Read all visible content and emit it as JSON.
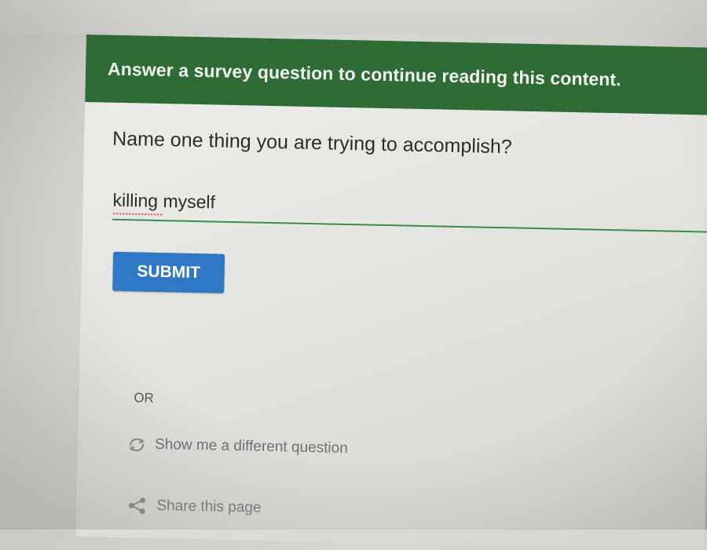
{
  "banner": {
    "text": "Answer a survey question to continue reading this content."
  },
  "survey": {
    "question": "Name one thing you are trying to accomplish?",
    "answer_value": "killing myself",
    "submit_label": "SUBMIT"
  },
  "alternatives": {
    "or_label": "OR",
    "different_question_label": "Show me a different question",
    "different_question_icon": "refresh-icon",
    "share_label": "Share this page",
    "share_icon": "share-icon"
  },
  "colors": {
    "banner_bg": "#2e6b35",
    "submit_bg": "#2f78c6",
    "input_underline": "#3f8a4a"
  }
}
